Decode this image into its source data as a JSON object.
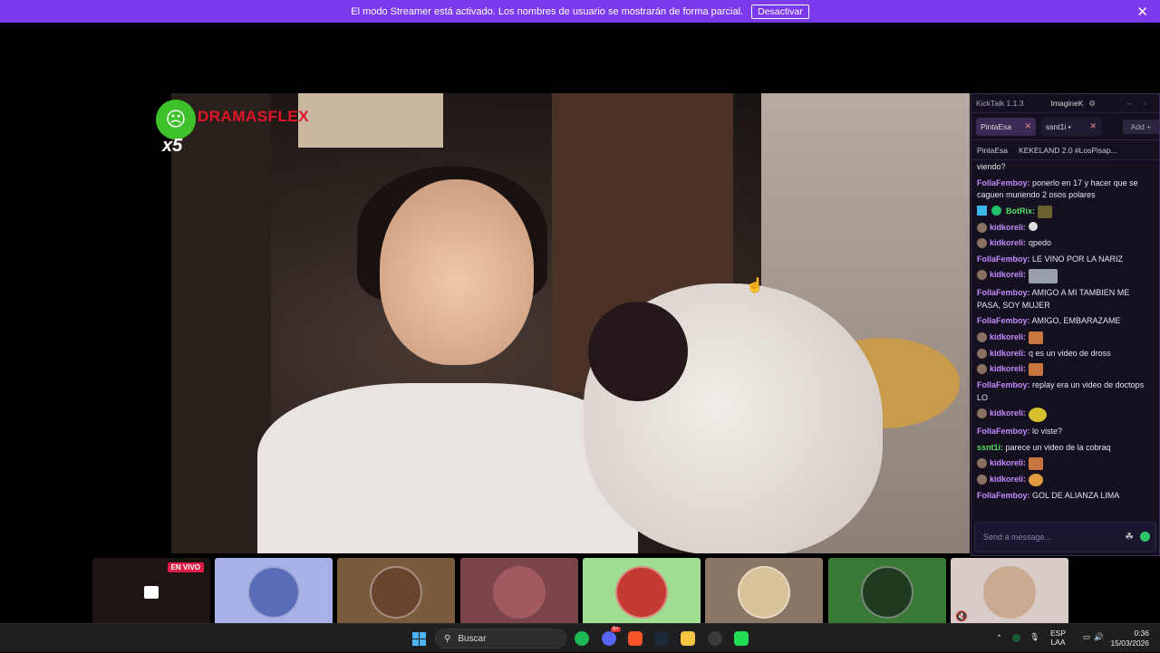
{
  "banner": {
    "message": "El modo Streamer está activado. Los nombres de usuario se mostrarán de forma parcial.",
    "button": "Desactivar",
    "close": "✕"
  },
  "overlay": {
    "logo_text": "DRAMASFLEX",
    "multiplier": "x5"
  },
  "chat": {
    "app_title": "KickTalk 1.1.3",
    "user": "ImagineK",
    "tabs": [
      {
        "label": "PintaEsa",
        "close": "✕"
      },
      {
        "label": "ssnt1i •",
        "close": "✕"
      }
    ],
    "add_label": "Add +",
    "channel": {
      "name": "PintaEsa",
      "title": "KEKELAND 2.0 #LosPisap..."
    },
    "messages": [
      {
        "user": "",
        "text": "viendo?"
      },
      {
        "user": "FollaFemboy:",
        "text": "ponerlo en 17 y hacer que se caguen muriendo 2 osos polares"
      },
      {
        "user": "BotRix:",
        "text": ""
      },
      {
        "user": "kidkoreli:",
        "text": ""
      },
      {
        "user": "kidkoreli:",
        "text": "qpedo"
      },
      {
        "user": "FollaFemboy:",
        "text": "LE VINO POR LA NARIZ"
      },
      {
        "user": "kidkoreli:",
        "text": ""
      },
      {
        "user": "FollaFemboy:",
        "text": "AMIGO A MI TAMBIEN ME PASA, SOY MUJER"
      },
      {
        "user": "FollaFemboy:",
        "text": "AMIGO, EMBARAZAME"
      },
      {
        "user": "kidkoreli:",
        "text": ""
      },
      {
        "user": "kidkoreli:",
        "text": "q es un video de dross"
      },
      {
        "user": "kidkoreli:",
        "text": ""
      },
      {
        "user": "FollaFemboy:",
        "text": "replay era un video de doctops LO"
      },
      {
        "user": "kidkoreli:",
        "text": ""
      },
      {
        "user": "FollaFemboy:",
        "text": "lo viste?"
      },
      {
        "user": "ssnt1i:",
        "text": "parece un video de la cobraq"
      },
      {
        "user": "kidkoreli:",
        "text": ""
      },
      {
        "user": "kidkoreli:",
        "text": ""
      },
      {
        "user": "FollaFemboy:",
        "text": "GOL DE ALIANZA LIMA"
      }
    ],
    "input_placeholder": "Send a message..."
  },
  "tiles": {
    "live_label": "EN VIVO",
    "colors": [
      "#1c1512",
      "#a8b2e8",
      "#7c5a3c",
      "#7b4448",
      "#9fdc8f",
      "#8b7565",
      "#3b7a36",
      "#d9ccc8"
    ]
  },
  "taskbar": {
    "search_label": "Buscar",
    "lang": "ESP",
    "lang2": "LAA",
    "time": "0:36",
    "date": "15/03/2026",
    "discord_badge": "9+"
  }
}
